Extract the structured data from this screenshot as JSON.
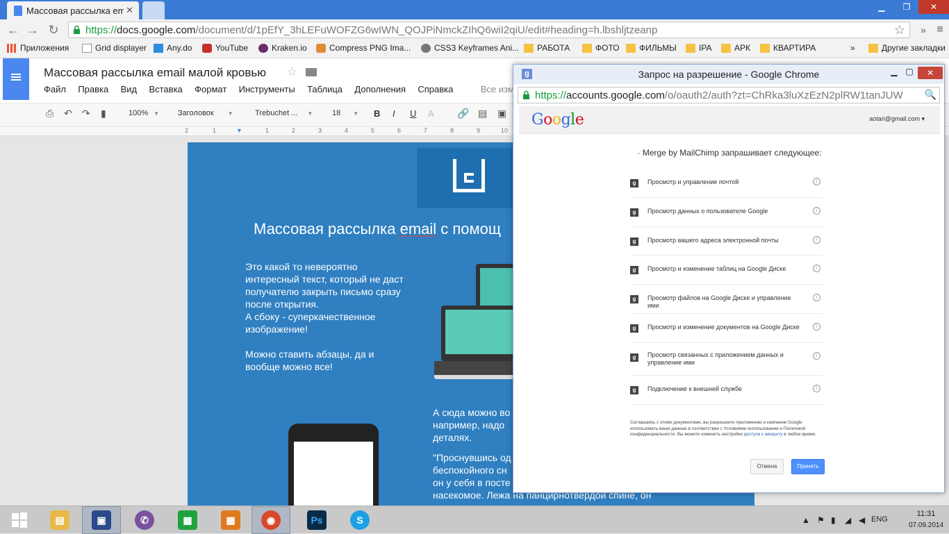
{
  "browser": {
    "tab_title": "Массовая рассылка ema",
    "url": {
      "scheme": "https://",
      "host": "docs.google.com",
      "path": "/document/d/1pEfY_3hLEFuWOFZG6wIWN_QOJPiNmckZIhQ6wiI2qiU/edit#heading=h.lbshljtzeanp"
    },
    "bookmarks": [
      {
        "label": "Приложения",
        "icon": "apps-grid-icon"
      },
      {
        "label": "Grid displayer",
        "icon": "page-icon"
      },
      {
        "label": "Any.do",
        "icon": "check-icon"
      },
      {
        "label": "YouTube",
        "icon": "youtube-icon"
      },
      {
        "label": "Kraken.io",
        "icon": "kraken-icon"
      },
      {
        "label": "Compress PNG Ima...",
        "icon": "panda-icon"
      },
      {
        "label": "CSS3 Keyframes Ani...",
        "icon": "gear-icon"
      },
      {
        "label": "РАБОТА",
        "icon": "folder-icon"
      },
      {
        "label": "ФОТО",
        "icon": "folder-icon"
      },
      {
        "label": "ФИЛЬМЫ",
        "icon": "folder-icon"
      },
      {
        "label": "IPA",
        "icon": "folder-icon"
      },
      {
        "label": "АРК",
        "icon": "folder-icon"
      },
      {
        "label": "КВАРТИРА",
        "icon": "folder-icon"
      }
    ],
    "more_bookmarks": "»",
    "other_bookmarks": "Другие закладки",
    "menu_overflow": "»"
  },
  "docs": {
    "title": "Массовая рассылка email малой кровью",
    "menu": [
      "Файл",
      "Правка",
      "Вид",
      "Вставка",
      "Формат",
      "Инструменты",
      "Таблица",
      "Дополнения",
      "Справка"
    ],
    "saved_status": "Все изменен",
    "toolbar": {
      "zoom": "100%",
      "style": "Заголовок",
      "font": "Trebuchet ...",
      "size": "18",
      "bold": "B",
      "italic": "I",
      "underline": "U",
      "text_color": "A"
    },
    "ruler": [
      "2",
      "1",
      "1",
      "2",
      "3",
      "4",
      "5",
      "6",
      "7",
      "8",
      "9",
      "10"
    ]
  },
  "email": {
    "headline_pre": "Массовая рассылка ",
    "headline_word": "email",
    "headline_post": " с помощ",
    "para1_lines": [
      "Это какой то невероятно",
      "интересный текст, который не даст",
      "получателю закрыть письмо сразу",
      "после открытия.",
      "А сбоку - суперкачественное",
      "изображение!"
    ],
    "para2_lines": [
      "Можно ставить абзацы, да и",
      "вообще можно все!"
    ],
    "para3_lines": [
      "А сюда можно во",
      "например, надо",
      "деталях."
    ],
    "para4_lines": [
      "\"Проснувшись од",
      "беспокойного сн",
      "он у себя в посте",
      "насекомое. Лежа на панцирнотвердой спине, он"
    ]
  },
  "popup": {
    "window_title": "Запрос на разрешение - Google Chrome",
    "url": {
      "scheme": "https://",
      "host": "accounts.google.com",
      "path": "/o/oauth2/auth?zt=ChRka3luXzEzN2plRW1tanJUW"
    },
    "google_logo": "Google",
    "account": "aotari@gmail.com",
    "heading": "Merge by MailChimp запрашивает следующее:",
    "permissions": [
      "Просмотр и управление почтой",
      "Просмотр данных о пользователе Google",
      "Просмотр вашего адреса электронной почты",
      "Просмотр и изменение таблиц на Google Диске",
      "Просмотр файлов на Google Диске и управление ими",
      "Просмотр и изменение документов на Google Диске",
      "Просмотр связанных с приложением данных и управление ими",
      "Подключение к внешней службе"
    ],
    "legal_pre": "Соглашаясь с этими документами, вы разрешаете приложению и компании Google использовать ваши данные в соответствии с Условиями использования и Политикой конфиденциальности. Вы можете изменить настройки ",
    "legal_link": "доступа к аккаунту",
    "legal_post": " в любое время.",
    "cancel_label": "Отмена",
    "accept_label": "Принять"
  },
  "taskbar": {
    "apps": [
      {
        "name": "file-explorer",
        "glyph": "▤",
        "color": "#e8b84a"
      },
      {
        "name": "save-disk",
        "glyph": "💾",
        "color": "#2b4a8a"
      },
      {
        "name": "viber",
        "glyph": "✆",
        "color": "#7b519d"
      },
      {
        "name": "store",
        "glyph": "▦",
        "color": "#1fa33f"
      },
      {
        "name": "tiles",
        "glyph": "▦",
        "color": "#e07a1f"
      },
      {
        "name": "chrome",
        "glyph": "◉",
        "color": "#d9482b"
      },
      {
        "name": "photoshop",
        "glyph": "Ps",
        "color": "#0b2a44"
      },
      {
        "name": "skype",
        "glyph": "S",
        "color": "#1ea0e6"
      }
    ],
    "lang": "ENG",
    "time": "11:31",
    "date": "07.09.2014"
  }
}
